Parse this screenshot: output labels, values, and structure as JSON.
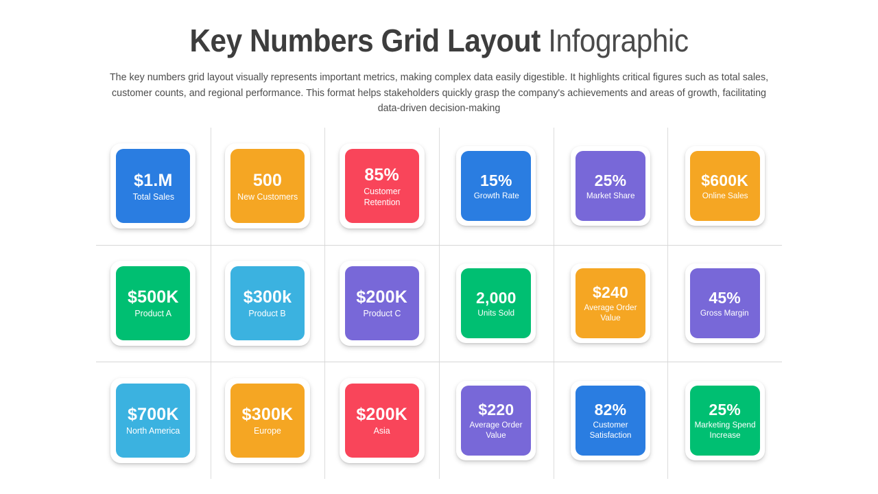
{
  "header": {
    "title_strong": "Key Numbers Grid Layout",
    "title_light": "Infographic",
    "subtitle": "The key numbers grid layout visually represents important metrics, making complex data easily digestible. It highlights critical figures such as total sales, customer counts, and regional performance. This format helps stakeholders quickly grasp the company's achievements and areas of growth, facilitating data-driven decision-making"
  },
  "palette": {
    "blue": "#2a7de1",
    "orange": "#f5a623",
    "red": "#f9455a",
    "purple": "#7868d8",
    "green": "#00bf72",
    "lightblue": "#3bb2e0",
    "card_frame": "#ffffff",
    "divider": "#dcdcdc",
    "title": "#3d3d3d",
    "subtitle": "#4c4c4c"
  },
  "grid": {
    "columns": 6,
    "rows": 3,
    "cards": [
      {
        "value": "$1.M",
        "label": "Total Sales",
        "color": "#2a7de1",
        "size": "lg"
      },
      {
        "value": "500",
        "label": "New Customers",
        "color": "#f5a623",
        "size": "lg"
      },
      {
        "value": "85%",
        "label": "Customer Retention",
        "color": "#f9455a",
        "size": "lg"
      },
      {
        "value": "15%",
        "label": "Growth Rate",
        "color": "#2a7de1",
        "size": "sm"
      },
      {
        "value": "25%",
        "label": "Market Share",
        "color": "#7868d8",
        "size": "sm"
      },
      {
        "value": "$600K",
        "label": "Online Sales",
        "color": "#f5a623",
        "size": "sm"
      },
      {
        "value": "$500K",
        "label": "Product A",
        "color": "#00bf72",
        "size": "lg"
      },
      {
        "value": "$300k",
        "label": "Product B",
        "color": "#3bb2e0",
        "size": "lg"
      },
      {
        "value": "$200K",
        "label": "Product C",
        "color": "#7868d8",
        "size": "lg"
      },
      {
        "value": "2,000",
        "label": "Units Sold",
        "color": "#00bf72",
        "size": "sm"
      },
      {
        "value": "$240",
        "label": "Average Order Value",
        "color": "#f5a623",
        "size": "sm"
      },
      {
        "value": "45%",
        "label": "Gross Margin",
        "color": "#7868d8",
        "size": "sm"
      },
      {
        "value": "$700K",
        "label": "North America",
        "color": "#3bb2e0",
        "size": "lg"
      },
      {
        "value": "$300K",
        "label": "Europe",
        "color": "#f5a623",
        "size": "lg"
      },
      {
        "value": "$200K",
        "label": "Asia",
        "color": "#f9455a",
        "size": "lg"
      },
      {
        "value": "$220",
        "label": "Average Order Value",
        "color": "#7868d8",
        "size": "sm"
      },
      {
        "value": "82%",
        "label": "Customer Satisfaction",
        "color": "#2a7de1",
        "size": "sm"
      },
      {
        "value": "25%",
        "label": "Marketing Spend Increase",
        "color": "#00bf72",
        "size": "sm"
      }
    ]
  }
}
